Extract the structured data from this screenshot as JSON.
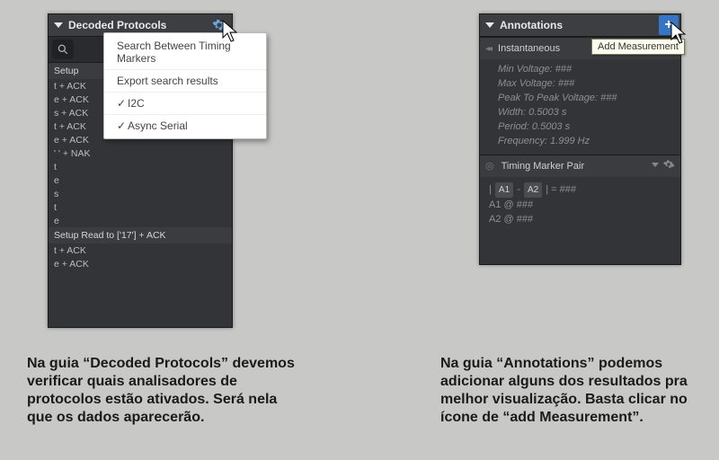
{
  "left": {
    "title": "Decoded Protocols",
    "dropdown": {
      "search_markers": "Search Between Timing Markers",
      "export": "Export search results",
      "opt1": "I2C",
      "opt2": "Async Serial"
    },
    "lines": {
      "setup1": "Setup",
      "l1": "t + ACK",
      "l2": "e + ACK",
      "l3": "s + ACK",
      "l4": "t + ACK",
      "l5": "e + ACK",
      "l6": "' ' + NAK",
      "l7": "t",
      "l8": "e",
      "l9": "s",
      "l10": "t",
      "l11": "e",
      "setup2": "Setup Read to ['17'] + ACK",
      "l12": "t + ACK",
      "l13": "e + ACK"
    }
  },
  "right": {
    "title": "Annotations",
    "tooltip": "Add Measurement",
    "inst_label": "Instantaneous",
    "meas": {
      "minv": "Min Voltage: ###",
      "maxv": "Max Voltage: ###",
      "p2p": "Peak To Peak Voltage: ###",
      "width": "Width: 0.5003 s",
      "period": "Period: 0.5003 s",
      "freq": "Frequency: 1.999 Hz"
    },
    "tmp_title": "Timing Marker Pair",
    "tmp": {
      "tagA1": "A1",
      "tagA2": "A2",
      "eq": " = ###",
      "row2": "A1  @  ###",
      "row3": "A2  @  ###"
    }
  },
  "captions": {
    "left": "Na guia “Decoded Protocols” devemos verificar quais analisadores de protocolos estão ativados. Será nela que os dados aparecerão.",
    "right": "Na guia “Annotations” podemos adicionar alguns dos resultados pra melhor visualização. Basta clicar no ícone de “add Measurement”."
  }
}
